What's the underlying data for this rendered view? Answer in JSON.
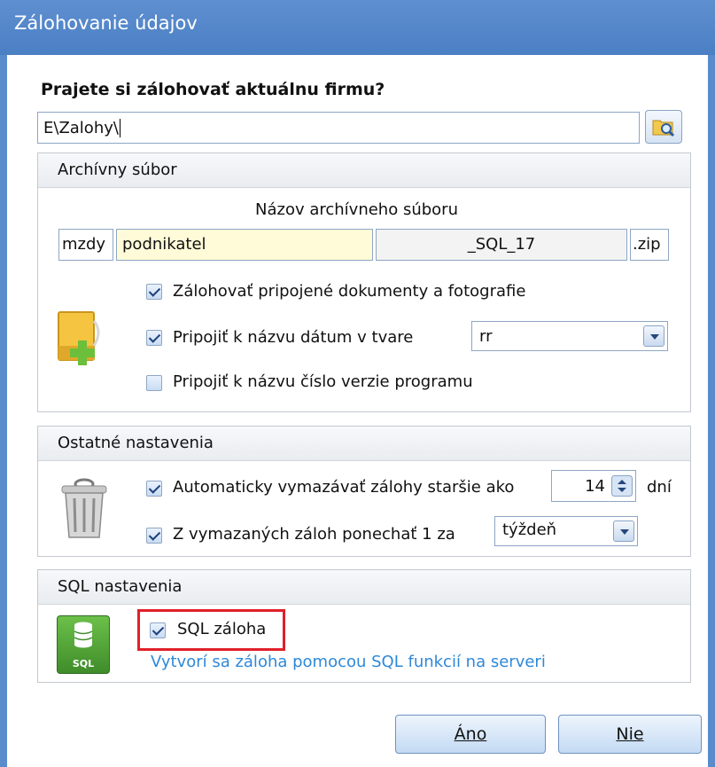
{
  "window": {
    "title": "Zálohovanie údajov"
  },
  "question": "Prajete si zálohovať aktuálnu firmu?",
  "path": {
    "value": "E\\Zalohy\\"
  },
  "archive": {
    "header": "Archívny súbor",
    "name_caption": "Názov archívneho súboru",
    "prefix": "mzdy",
    "company": "podnikatel",
    "suffix": "_SQL_17",
    "extension": ".zip",
    "opt_attachments": {
      "label": "Zálohovať pripojené dokumenty a fotografie",
      "checked": true
    },
    "opt_date": {
      "label": "Pripojiť k názvu dátum v tvare",
      "checked": true
    },
    "date_format": "rr",
    "opt_version": {
      "label": "Pripojiť k názvu číslo verzie programu",
      "checked": false
    }
  },
  "other": {
    "header": "Ostatné nastavenia",
    "opt_delete": {
      "label": "Automaticky vymazávať zálohy staršie ako",
      "checked": true
    },
    "days_value": "14",
    "days_unit": "dní",
    "opt_keep": {
      "label": "Z vymazaných záloh ponechať 1 za",
      "checked": true
    },
    "keep_period": "týždeň"
  },
  "sql": {
    "header": "SQL nastavenia",
    "opt_sql": {
      "label": "SQL záloha",
      "checked": true
    },
    "icon_text": "SQL",
    "note": "Vytvorí sa záloha pomocou SQL funkcií na serveri"
  },
  "buttons": {
    "yes": "Áno",
    "no": "Nie"
  },
  "colors": {
    "titlebar": "#4b7fc4",
    "highlight": "#e0202a",
    "note": "#2e88d8",
    "company_field": "#fffbd8"
  }
}
